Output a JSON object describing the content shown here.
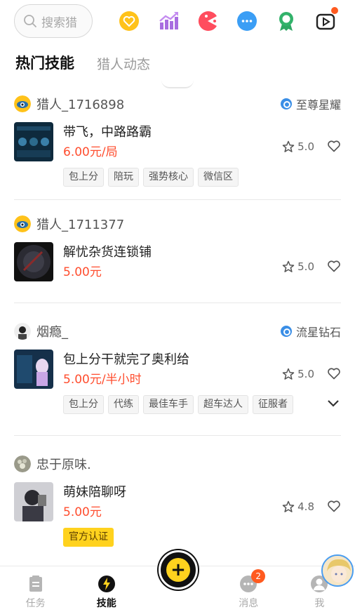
{
  "search": {
    "placeholder": "搜索猎"
  },
  "top_icons": [
    "heart-coin-icon",
    "chart-icon",
    "pacman-icon",
    "chat-bubble-icon",
    "medal-icon",
    "video-icon"
  ],
  "tabs": [
    {
      "label": "热门技能",
      "active": true
    },
    {
      "label": "猎人动态",
      "active": false
    }
  ],
  "cards": [
    {
      "user": "猎人_1716898",
      "rank": "至尊星耀",
      "title": "带飞，中路路霸",
      "price": "6.00元/局",
      "rating": "5.0",
      "tags": [
        "包上分",
        "陪玩",
        "强势核心",
        "微信区"
      ]
    },
    {
      "user": "猎人_1711377",
      "rank": "",
      "title": "解忧杂货连锁铺",
      "price": "5.00元",
      "rating": "5.0",
      "tags": []
    },
    {
      "user": "烟瘾_",
      "rank": "流星钻石",
      "title": "包上分干就完了奥利给",
      "price": "5.00元/半小时",
      "rating": "5.0",
      "tags": [
        "包上分",
        "代练",
        "最佳车手",
        "超车达人",
        "征服者"
      ]
    },
    {
      "user": "忠于原味.",
      "rank": "",
      "title": "萌妹陪聊呀",
      "price": "5.00元",
      "rating": "4.8",
      "tags": [
        "官方认证"
      ]
    }
  ],
  "bottom_nav": [
    {
      "label": "任务",
      "icon": "task-list-icon"
    },
    {
      "label": "技能",
      "icon": "lightning-icon"
    },
    {
      "label": "消息",
      "icon": "message-icon",
      "badge": "2"
    },
    {
      "label": "我",
      "icon": "profile-icon"
    }
  ],
  "colors": {
    "accent": "#ffd21e",
    "price": "#ff4d2e",
    "rank_male": "#3a8ee6"
  }
}
